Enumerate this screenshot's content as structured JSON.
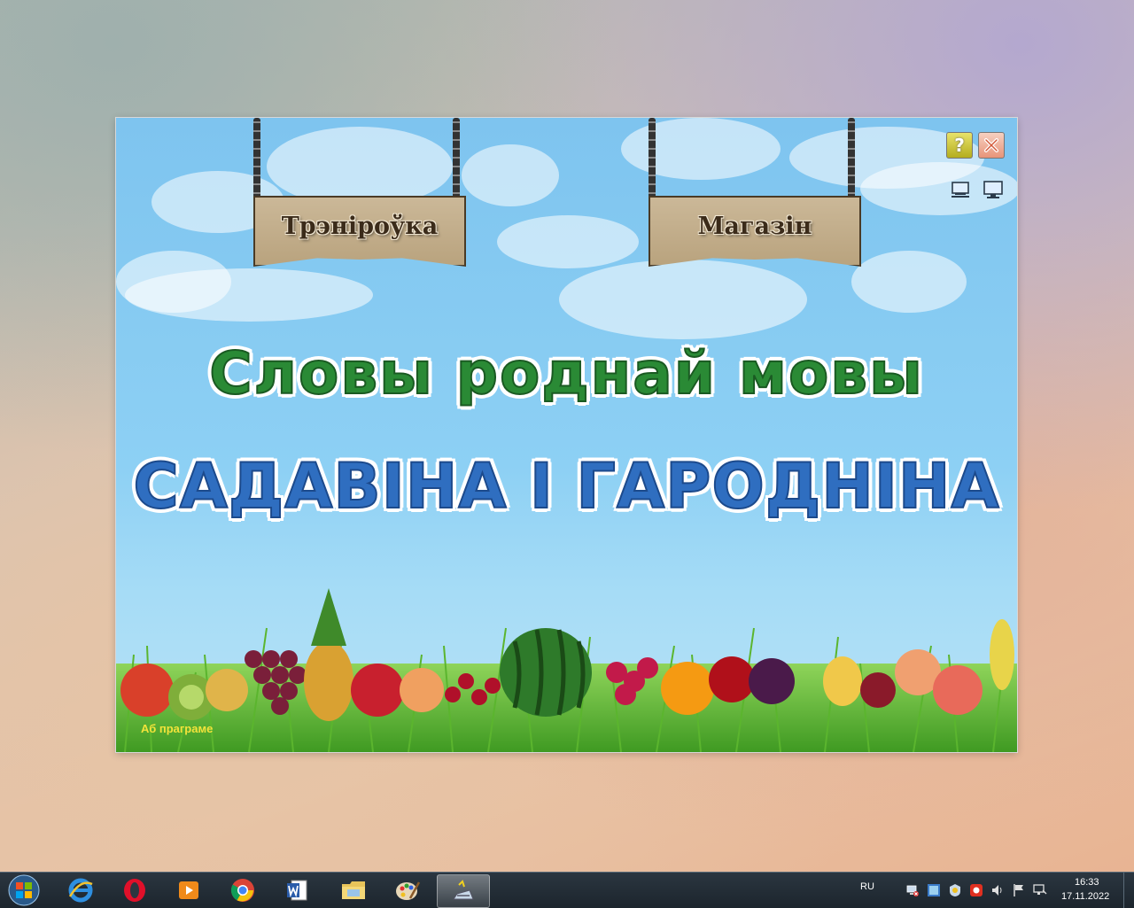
{
  "app": {
    "signs": {
      "training": "Трэніроўка",
      "shop": "Магазін"
    },
    "title_line1": "Словы роднай мовы",
    "title_line2": "САДАВІНА І ГАРОДНІНА",
    "help_glyph": "?",
    "about_link": "Аб праграме"
  },
  "taskbar": {
    "items": [
      {
        "name": "internet-explorer",
        "icon": "ie-icon"
      },
      {
        "name": "opera",
        "icon": "opera-icon"
      },
      {
        "name": "media-player",
        "icon": "media-player-icon"
      },
      {
        "name": "chrome",
        "icon": "chrome-icon"
      },
      {
        "name": "word",
        "icon": "word-icon"
      },
      {
        "name": "file-explorer",
        "icon": "folder-icon"
      },
      {
        "name": "paint",
        "icon": "paint-icon"
      },
      {
        "name": "active-app",
        "icon": "app-icon"
      }
    ],
    "language": "RU",
    "time": "16:33",
    "date": "17.11.2022"
  },
  "colors": {
    "title_green": "#2a8a35",
    "title_blue": "#2f6ec0",
    "about_link": "#f2e33a",
    "sky": "#8dd0f4"
  }
}
